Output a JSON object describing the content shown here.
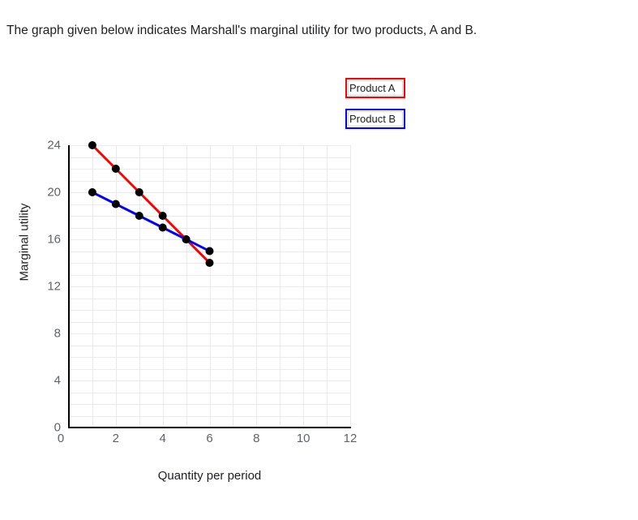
{
  "question": {
    "text": "The graph given below indicates Marshall's marginal utility for two products, A and B."
  },
  "legend": {
    "items": [
      {
        "label": "Product A",
        "color": "#ff0000"
      },
      {
        "label": "Product B",
        "color": "#0000ff"
      }
    ]
  },
  "chart_data": {
    "type": "line",
    "title": "",
    "xlabel": "Quantity per period",
    "ylabel": "Marginal utility",
    "xlim": [
      0,
      12
    ],
    "ylim": [
      0,
      24
    ],
    "xticks": [
      0,
      2,
      4,
      6,
      8,
      10,
      12
    ],
    "yticks": [
      0,
      4,
      8,
      12,
      16,
      20,
      24
    ],
    "xtick_labels": [
      "0",
      "2",
      "4",
      "6",
      "8",
      "10",
      "12"
    ],
    "ytick_labels": [
      "0",
      "4",
      "8",
      "12",
      "16",
      "20",
      "24"
    ],
    "grid": true,
    "grid_step_x": 1,
    "grid_step_y": 1,
    "legend_position": "top-right-outside",
    "marker": "circle",
    "marker_color": "#000000",
    "series": [
      {
        "name": "Product A",
        "color": "#ff0000",
        "x": [
          1,
          2,
          3,
          4,
          5,
          6
        ],
        "values": [
          24,
          22,
          20,
          18,
          16,
          14
        ]
      },
      {
        "name": "Product B",
        "color": "#0000ff",
        "x": [
          1,
          2,
          3,
          4,
          5,
          6
        ],
        "values": [
          20,
          19,
          18,
          17,
          16,
          15
        ]
      }
    ]
  }
}
